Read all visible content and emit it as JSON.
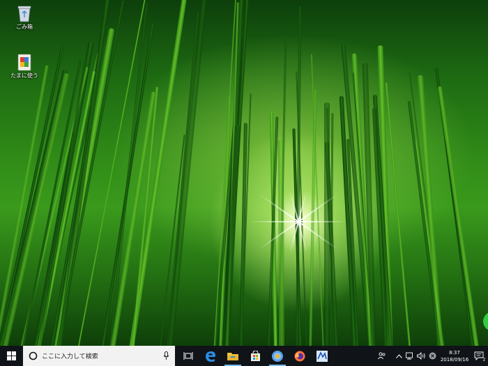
{
  "desktop": {
    "icons": [
      {
        "label": "ごみ箱",
        "icon": "recycle-bin-icon"
      },
      {
        "label": "たまに使う",
        "icon": "folder-icon"
      }
    ]
  },
  "taskbar": {
    "start_icon": "windows-logo-icon",
    "search": {
      "placeholder": "ここに入力して検索",
      "mic_icon": "microphone-icon"
    },
    "pinned": [
      "task-view-icon",
      "edge-icon",
      "file-explorer-icon",
      "store-icon",
      "chrome-icon",
      "firefox-icon",
      "app-icon"
    ],
    "tray": {
      "icons": [
        "people-icon",
        "chevron-up-icon",
        "network-icon",
        "volume-icon",
        "close-circle-icon"
      ],
      "time": "8:37",
      "date": "2018/09/16",
      "notification_icon": "action-center-icon",
      "notification_count": "2"
    }
  }
}
